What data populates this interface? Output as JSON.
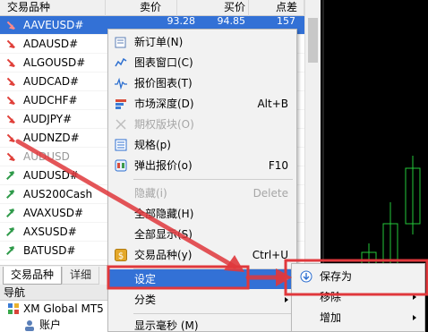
{
  "market_watch": {
    "columns": [
      "交易品种",
      "卖价",
      "买价",
      "点差"
    ],
    "rows": [
      {
        "symbol": "AAVEUSD#",
        "dir": "down",
        "bid": "93.28",
        "ask": "94.85",
        "spread": "157",
        "selected": true
      },
      {
        "symbol": "ADAUSD#",
        "dir": "down"
      },
      {
        "symbol": "ALGOUSD#",
        "dir": "down"
      },
      {
        "symbol": "AUDCAD#",
        "dir": "down"
      },
      {
        "symbol": "AUDCHF#",
        "dir": "down"
      },
      {
        "symbol": "AUDJPY#",
        "dir": "down"
      },
      {
        "symbol": "AUDNZD#",
        "dir": "down"
      },
      {
        "symbol": "AUDUSD",
        "dir": "down",
        "faded": true
      },
      {
        "symbol": "AUDUSD#",
        "dir": "up"
      },
      {
        "symbol": "AUS200Cash",
        "dir": "up"
      },
      {
        "symbol": "AVAXUSD#",
        "dir": "up"
      },
      {
        "symbol": "AXSUSD#",
        "dir": "up"
      },
      {
        "symbol": "BATUSD#",
        "dir": "up"
      }
    ],
    "tabs": [
      "交易品种",
      "详细"
    ]
  },
  "navigator": {
    "title": "导航",
    "items": [
      "XM Global MT5",
      "账户"
    ]
  },
  "context_menu": {
    "items": [
      {
        "label": "新订单(N)",
        "icon": "new-order-icon"
      },
      {
        "label": "图表窗口(C)",
        "icon": "chart-window-icon"
      },
      {
        "label": "报价图表(T)",
        "icon": "tick-chart-icon"
      },
      {
        "label": "市场深度(D)",
        "shortcut": "Alt+B",
        "icon": "market-depth-icon"
      },
      {
        "label": "期权版块(O)",
        "icon": "options-icon",
        "disabled": true
      },
      {
        "label": "规格(p)",
        "icon": "specification-icon"
      },
      {
        "label": "弹出报价(o)",
        "shortcut": "F10",
        "icon": "popup-prices-icon"
      },
      {
        "label": "隐藏(i)",
        "shortcut": "Delete",
        "disabled": true
      },
      {
        "label": "全部隐藏(H)"
      },
      {
        "label": "全部显示(S)"
      },
      {
        "label": "交易品种(y)",
        "shortcut": "Ctrl+U",
        "icon": "symbols-icon"
      },
      {
        "label": "设定",
        "submenu": true,
        "highlight": true
      },
      {
        "label": "分类",
        "submenu": true
      },
      {
        "label": "显示毫秒 (M)"
      }
    ]
  },
  "submenu": {
    "items": [
      {
        "label": "保存为",
        "icon": "save-icon"
      },
      {
        "label": "移除",
        "submenu": true
      },
      {
        "label": "增加",
        "submenu": true
      }
    ]
  },
  "colors": {
    "selection": "#3371d6",
    "annotation": "#e0383c",
    "up_arrow": "#2f9a4a",
    "down_arrow": "#e0403a",
    "candle_up": "#25c93a"
  }
}
